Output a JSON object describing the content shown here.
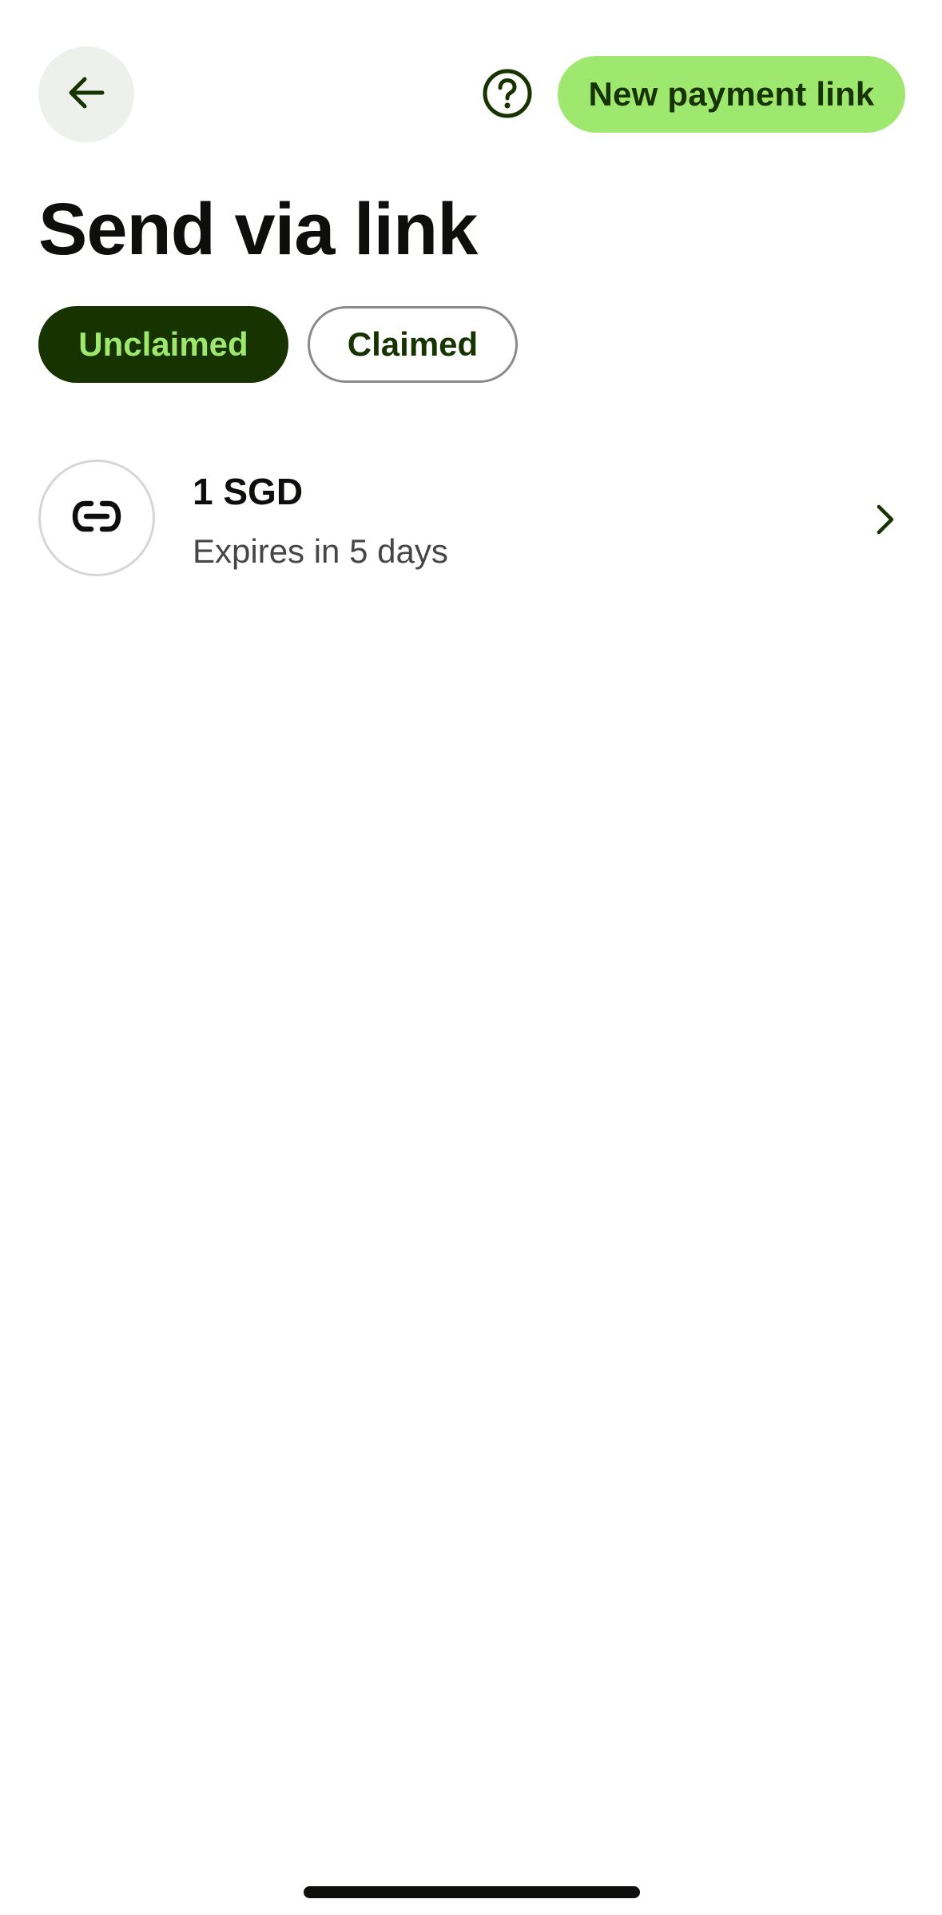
{
  "header": {
    "new_payment_link_label": "New payment link",
    "icons": {
      "back": "arrow-left-icon",
      "help": "question-circle-icon"
    }
  },
  "page": {
    "title": "Send via link"
  },
  "tabs": [
    {
      "label": "Unclaimed",
      "selected": true
    },
    {
      "label": "Claimed",
      "selected": false
    }
  ],
  "links": [
    {
      "amount": "1 SGD",
      "status": "Expires in 5 days",
      "icon": "link-icon"
    }
  ],
  "colors": {
    "accent": "#9fe870",
    "dark_green": "#163300",
    "text_primary": "#0e0f0c",
    "text_secondary": "#454745"
  }
}
